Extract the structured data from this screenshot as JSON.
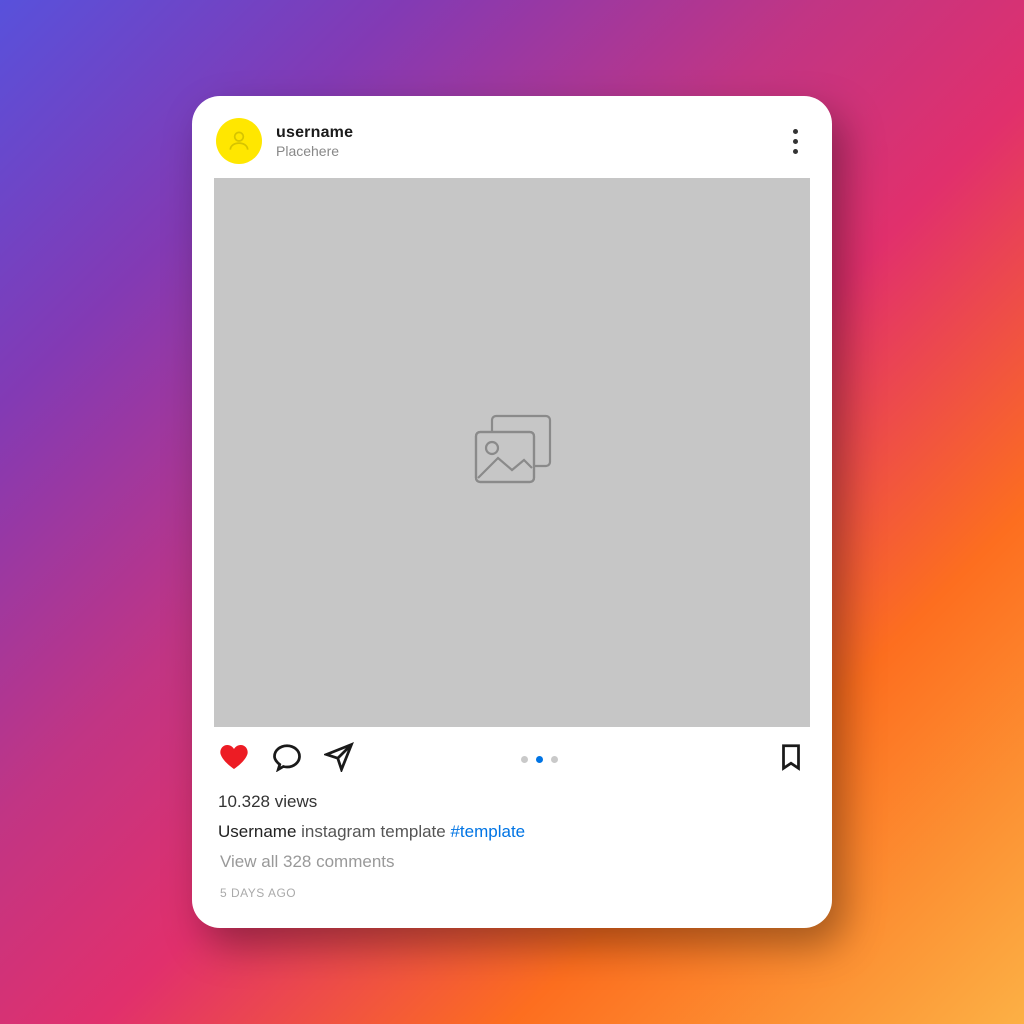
{
  "header": {
    "username": "username",
    "location": "Placehere"
  },
  "post": {
    "views_text": "10.328 views",
    "caption_username": "Username",
    "caption_text": "instagram template",
    "hashtag": "#template",
    "comments_link": "View all 328 comments",
    "timestamp": "5 DAYS AGO"
  },
  "pagination": {
    "count": 3,
    "active_index": 1
  },
  "icons": {
    "avatar": "person-icon",
    "more": "more-vertical-icon",
    "placeholder": "image-placeholder-icon",
    "like": "heart-icon",
    "comment": "speech-bubble-icon",
    "share": "paper-plane-icon",
    "bookmark": "bookmark-icon"
  },
  "colors": {
    "like_fill": "#ed1c24",
    "avatar_bg": "#ffe700",
    "link_blue": "#0074e4"
  }
}
